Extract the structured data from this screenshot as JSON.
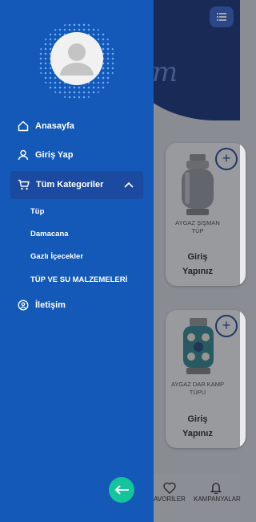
{
  "background": {
    "header_script": "m",
    "products": [
      {
        "title_line1": "AYGAZ ŞİŞMAN",
        "title_line2": "TÜP",
        "login_line1": "Giriş",
        "login_line2": "Yapınız"
      },
      {
        "title_line1": "AYGAZ DAR KAMP",
        "title_line2": "TÜPÜ",
        "login_line1": "Giriş",
        "login_line2": "Yapınız"
      }
    ],
    "add_symbol": "+",
    "bottom_nav": {
      "favorites": "AVORİLER",
      "campaigns": "KAMPANYALAR"
    }
  },
  "drawer": {
    "menu": {
      "home": "Anasayfa",
      "login": "Giriş Yap",
      "categories": "Tüm Kategoriler",
      "contact": "İletişim"
    },
    "subcategories": [
      "Tüp",
      "Damacana",
      "Gazlı İçecekler",
      "TÜP VE SU MALZEMELERİ"
    ]
  },
  "colors": {
    "drawer": "#1458b8",
    "accent": "#14c49a",
    "header": "#0d2a6e"
  }
}
